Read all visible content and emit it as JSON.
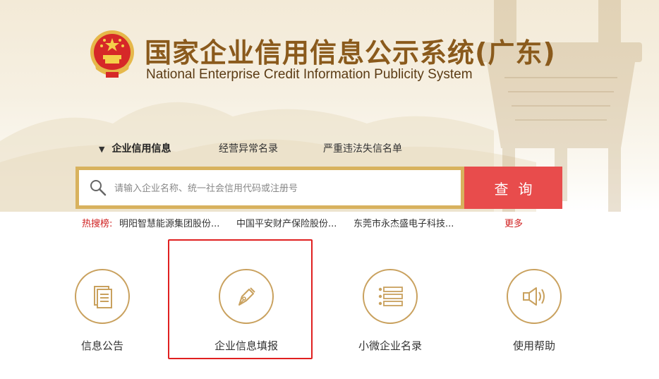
{
  "header": {
    "title_cn": "国家企业信用信息公示系统(广东)",
    "title_en": "National Enterprise Credit Information Publicity System",
    "emblem_icon": "national-emblem-icon"
  },
  "tabs": [
    {
      "label": "企业信用信息",
      "active": true
    },
    {
      "label": "经营异常名录",
      "active": false
    },
    {
      "label": "严重违法失信名单",
      "active": false
    }
  ],
  "search": {
    "placeholder": "请输入企业名称、统一社会信用代码或注册号",
    "button_label": "查询"
  },
  "hot_search": {
    "label": "热搜榜:",
    "items": [
      "明阳智慧能源集团股份...",
      "中国平安财产保险股份...",
      "东莞市永杰盛电子科技..."
    ],
    "more_label": "更多"
  },
  "features": [
    {
      "label": "信息公告",
      "icon": "document-icon"
    },
    {
      "label": "企业信息填报",
      "icon": "pen-nib-icon"
    },
    {
      "label": "小微企业名录",
      "icon": "list-icon"
    },
    {
      "label": "使用帮助",
      "icon": "speaker-icon"
    }
  ],
  "colors": {
    "gold": "#c9a15e",
    "search_border": "#d8b25e",
    "search_button": "#e84c4c",
    "title_brown": "#8a5a1c",
    "hot_red": "#d02020",
    "highlight_red": "#e02020"
  }
}
